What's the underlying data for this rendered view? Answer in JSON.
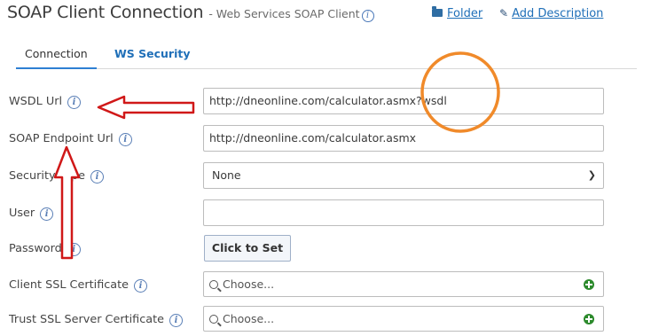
{
  "header": {
    "title": "SOAP Client Connection",
    "subtitle": "- Web Services SOAP Client",
    "info_glyph": "i",
    "folder_label": "Folder",
    "add_description_label": "Add Description"
  },
  "tabs": [
    {
      "label": "Connection",
      "active": true
    },
    {
      "label": "WS Security",
      "active": false
    }
  ],
  "form": {
    "info_glyph": "i",
    "wsdl_url": {
      "label": "WSDL Url",
      "value": "http://dneonline.com/calculator.asmx?wsdl"
    },
    "soap_endpoint_url": {
      "label": "SOAP Endpoint Url",
      "value": "http://dneonline.com/calculator.asmx"
    },
    "security_type": {
      "label": "Security Type",
      "value": "None"
    },
    "user": {
      "label": "User",
      "value": ""
    },
    "password": {
      "label": "Password",
      "button_label": "Click to Set"
    },
    "client_ssl_certificate": {
      "label": "Client SSL Certificate",
      "placeholder": "Choose..."
    },
    "trust_ssl_server_certificate": {
      "label": "Trust SSL Server Certificate",
      "placeholder": "Choose..."
    }
  },
  "colors": {
    "link": "#1f6fb8",
    "tab_underline": "#2e7fd3",
    "annotation_arrow": "#d01818",
    "annotation_circle": "#f08a2a",
    "add_icon": "#2c8a2c"
  },
  "icons": [
    "info-icon",
    "folder-icon",
    "pencil-icon",
    "chevron-down-icon",
    "search-icon",
    "plus-circle-icon"
  ]
}
